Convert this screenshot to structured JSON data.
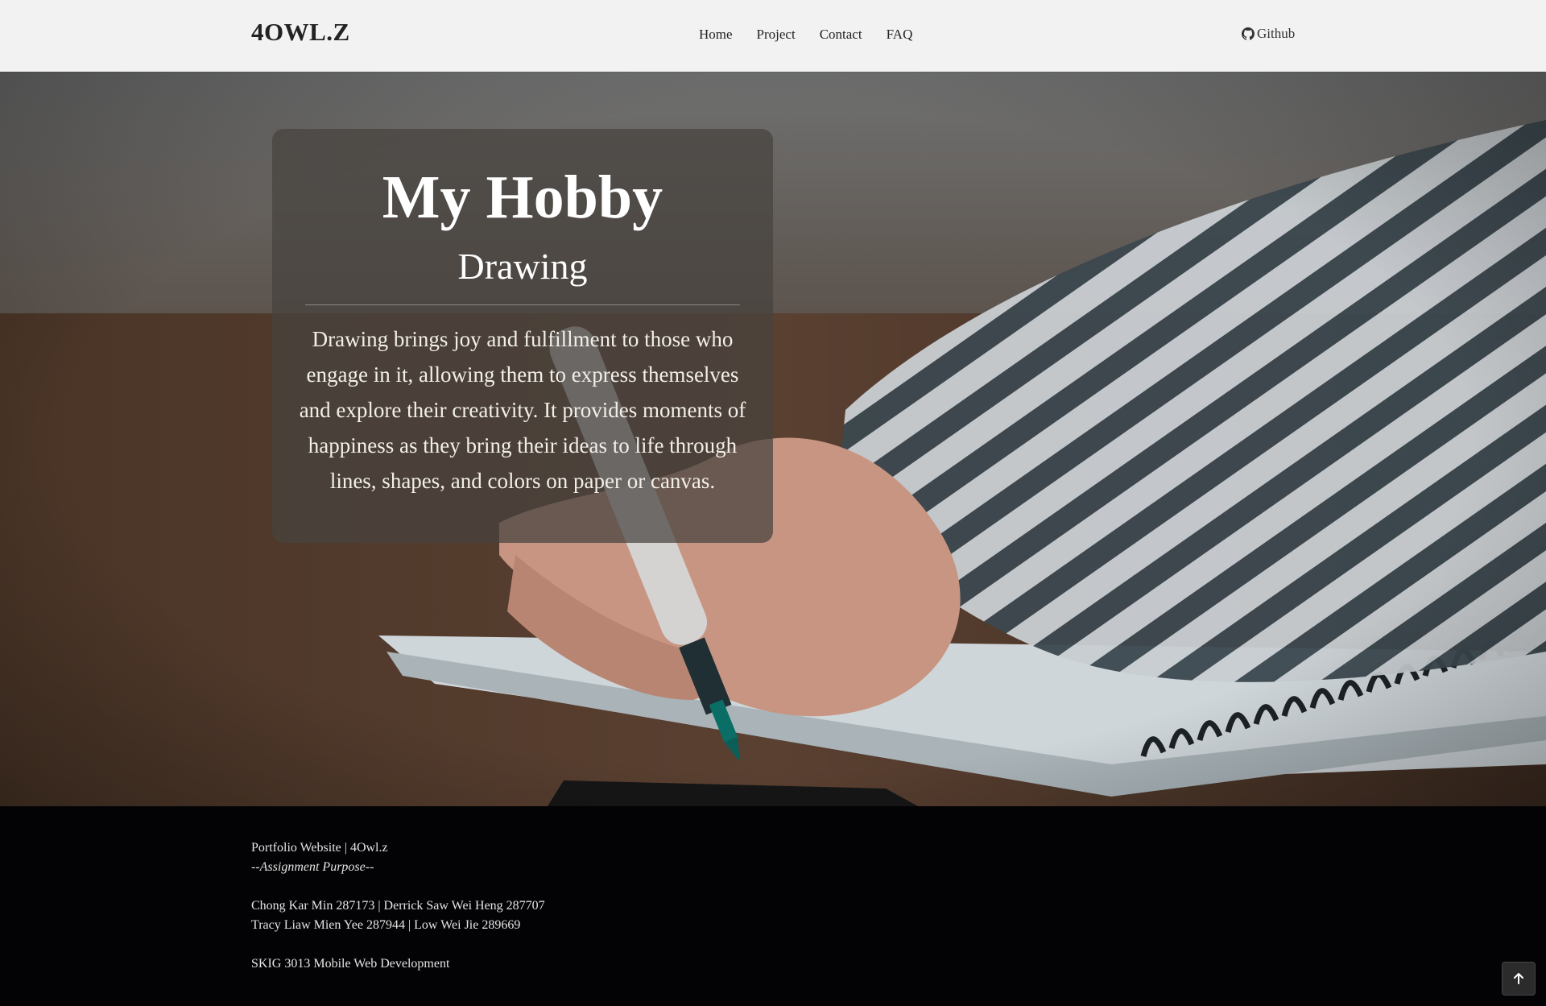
{
  "navbar": {
    "brand": "4OWL.Z",
    "links": [
      "Home",
      "Project",
      "Contact",
      "FAQ"
    ],
    "github_label": "Github"
  },
  "hero": {
    "title": "My Hobby",
    "subtitle": "Drawing",
    "description": "Drawing brings joy and fulfillment to those who engage in it, allowing them to express themselves and explore their creativity. It provides moments of happiness as they bring their ideas to life through lines, shapes, and colors on paper or canvas."
  },
  "footer": {
    "line1": "Portfolio Website | 4Owl.z",
    "line2": "--Assignment Purpose--",
    "line3": "Chong Kar Min 287173 | Derrick Saw Wei Heng 287707",
    "line4": "Tracy Liaw Mien Yee 287944 | Low Wei Jie 289669",
    "line5": "SKIG 3013 Mobile Web Development"
  },
  "icons": {
    "github": "github-icon",
    "back_to_top": "arrow-up-icon"
  }
}
